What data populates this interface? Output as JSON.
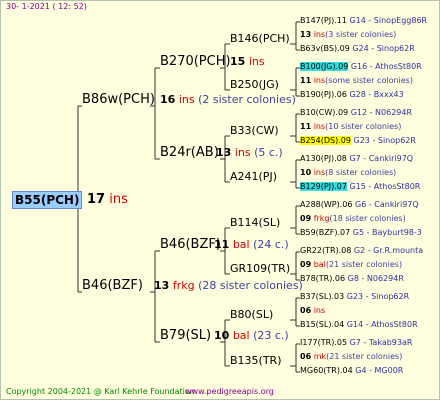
{
  "header": "30-   1-2021  ( 12:  52)",
  "footer": {
    "copyright": "Copyright 2004-2021 @ Karl Kehrle Foundation",
    "site": "www.pedigreeapis.org"
  },
  "root": {
    "name": "B55(PCH)",
    "num": "17",
    "ins": "ins"
  },
  "gen1": [
    {
      "name": "B86w(PCH)",
      "num": "16",
      "ins": "ins",
      "sis": "(2 sister colonies)"
    },
    {
      "name": "B46(BZF)",
      "num": "13",
      "ins": "frkg",
      "sis": "(28 sister colonies)"
    }
  ],
  "gen2": [
    {
      "name": "B270(PCH)",
      "num": "15",
      "ins": "ins"
    },
    {
      "name": "B24r(AB)",
      "num": "13",
      "ins": "ins",
      "sis": "(5 c.)"
    },
    {
      "name": "B46(BZF)",
      "num": "11",
      "ins": "bal",
      "sis": "(24 c.)"
    },
    {
      "name": "B79(SL)",
      "num": "10",
      "ins": "bal",
      "sis": "(23 c.)"
    }
  ],
  "gen3": [
    {
      "name": "B146(PCH)"
    },
    {
      "name": "B250(JG)"
    },
    {
      "name": "B33(CW)"
    },
    {
      "name": "A241(PJ)"
    },
    {
      "name": "B114(SL)"
    },
    {
      "name": "GR109(TR)"
    },
    {
      "name": "B80(SL)"
    },
    {
      "name": "B135(TR)"
    }
  ],
  "gen4": [
    {
      "top": "B147(PJ).11",
      "topInfo": "G14 - SinopEgg86R",
      "mid": "13",
      "midIns": "ins",
      "midSis": "(3 sister colonies)",
      "bot": "B63v(BS).09",
      "botInfo": "G24 - Sinop62R"
    },
    {
      "top": "B100(JG).09",
      "topInfo": "G16 - AthosSt80R",
      "topHl": "hl",
      "mid": "11",
      "midIns": "ins",
      "midSis": "(some sister colonies)",
      "bot": "B190(PJ).06",
      "botInfo": "G28 - Bxxx43"
    },
    {
      "top": "B10(CW).09",
      "topInfo": "G12 - N06294R",
      "mid": "11",
      "midIns": "ins",
      "midSis": "(10 sister colonies)",
      "bot": "B254(DS).09",
      "botInfo": "G23 - Sinop62R",
      "botHl": "hlY"
    },
    {
      "top": "A130(PJ).08",
      "topInfo": "G7 - Cankiri97Q",
      "mid": "10",
      "midIns": "ins",
      "midSis": "(8 sister colonies)",
      "bot": "B129(PJ).07",
      "botInfo": "G15 - AthosSt80R",
      "botHl": "hl"
    },
    {
      "top": "A288(WP).06",
      "topInfo": "G6 - Cankiri97Q",
      "mid": "09",
      "midIns": "frkg",
      "midSis": "(18 sister colonies)",
      "bot": "B59(BZF).07",
      "botInfo": "G5 - Bayburt98-3"
    },
    {
      "top": "GR22(TR).08",
      "topInfo": "G2 - Gr.R.mounta",
      "mid": "09",
      "midIns": "bal",
      "midSis": "(21 sister colonies)",
      "bot": "B78(TR).06",
      "botInfo": "G8 - N06294R"
    },
    {
      "top": "B37(SL).03",
      "topInfo": "G23 - Sinop62R",
      "mid": "06",
      "midIns": "ins",
      "midSis": "",
      "bot": "B15(SL).04",
      "botInfo": "G14 - AthosSt80R"
    },
    {
      "top": "I177(TR).05",
      "topInfo": "G7 - Takab93aR",
      "mid": "06",
      "midIns": "mk",
      "midSis": "(21 sister colonies)",
      "bot": "MG60(TR).04",
      "botInfo": "G4 - MG00R"
    }
  ]
}
